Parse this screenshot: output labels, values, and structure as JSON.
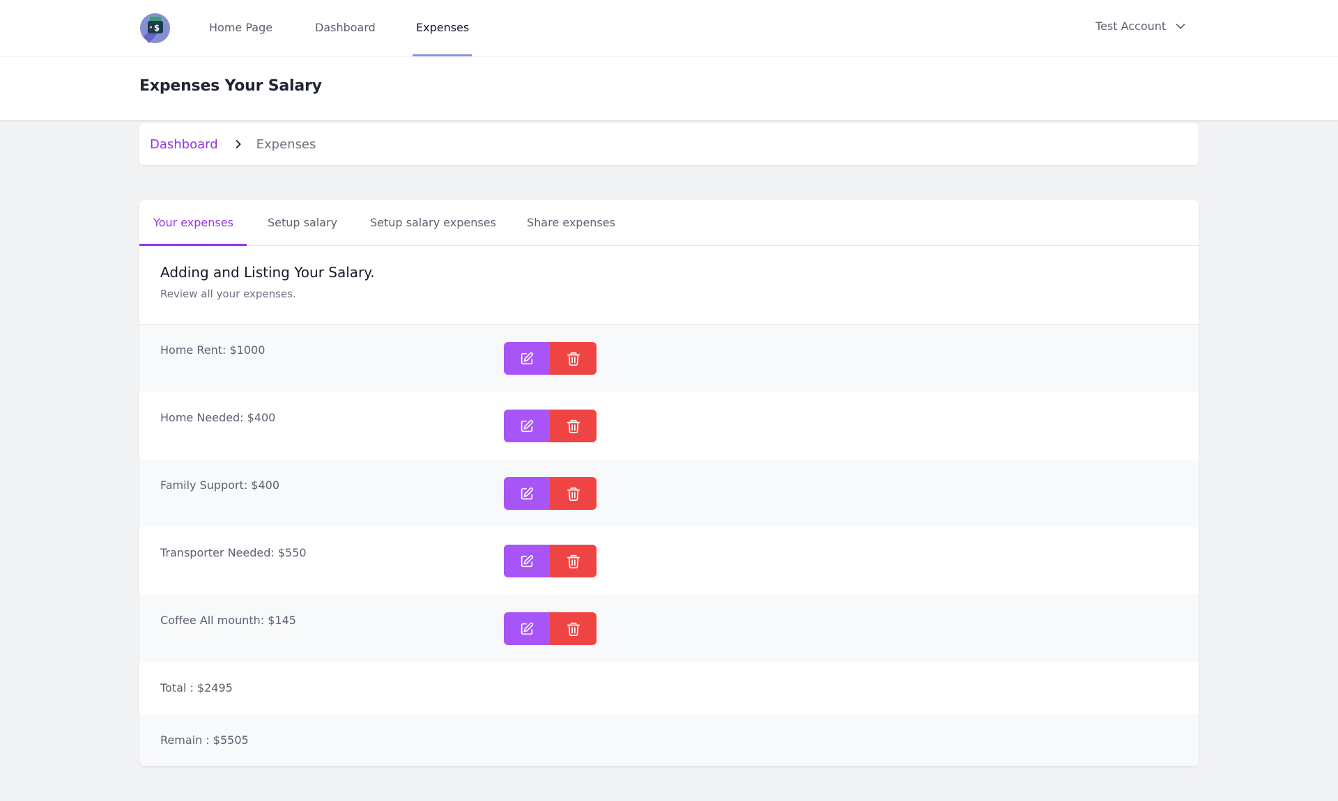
{
  "nav": {
    "logo_icon": "wallet-dollar-icon",
    "links": [
      {
        "label": "Home Page",
        "active": false
      },
      {
        "label": "Dashboard",
        "active": false
      },
      {
        "label": "Expenses",
        "active": true
      }
    ],
    "account_label": "Test Account",
    "account_icon": "chevron-down-icon"
  },
  "page": {
    "title": "Expenses Your Salary"
  },
  "breadcrumb": {
    "items": [
      "Dashboard",
      "Expenses"
    ],
    "separator_icon": "chevron-right-icon"
  },
  "tabs": [
    {
      "label": "Your expenses",
      "active": true
    },
    {
      "label": "Setup salary",
      "active": false
    },
    {
      "label": "Setup salary expenses",
      "active": false
    },
    {
      "label": "Share expenses",
      "active": false
    }
  ],
  "section": {
    "title": "Adding and Listing Your Salary.",
    "subtitle": "Review all your expenses."
  },
  "expenses": [
    {
      "label": "Home Rent: $1000"
    },
    {
      "label": "Home Needed: $400"
    },
    {
      "label": "Family Support: $400"
    },
    {
      "label": "Transporter Needed: $550"
    },
    {
      "label": "Coffee All mounth: $145"
    }
  ],
  "actions": {
    "edit_icon": "edit-icon",
    "delete_icon": "trash-icon"
  },
  "summary": {
    "total": "Total : $2495",
    "remain": "Remain : $5505"
  },
  "colors": {
    "accent": "#9333ea",
    "edit_button": "#a855f7",
    "delete_button": "#ef4444",
    "nav_underline": "#8b8fe8"
  }
}
